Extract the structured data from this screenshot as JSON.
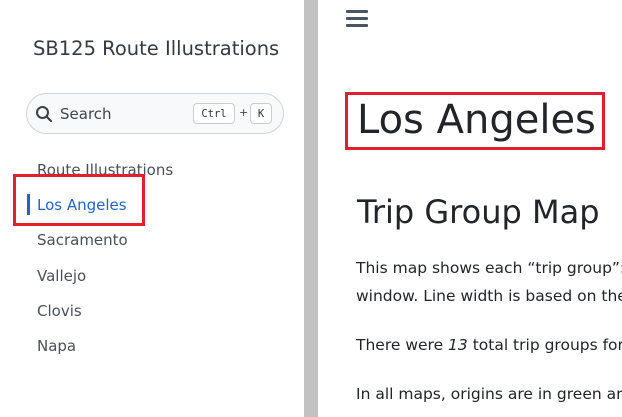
{
  "sidebar": {
    "site_title": "SB125 Route Illustrations",
    "search": {
      "placeholder": "Search",
      "shortcut_ctrl": "Ctrl",
      "shortcut_plus": "+",
      "shortcut_key": "K"
    },
    "items": [
      {
        "label": "Route Illustrations",
        "active": false
      },
      {
        "label": "Los Angeles",
        "active": true
      },
      {
        "label": "Sacramento",
        "active": false
      },
      {
        "label": "Vallejo",
        "active": false
      },
      {
        "label": "Clovis",
        "active": false
      },
      {
        "label": "Napa",
        "active": false
      }
    ]
  },
  "main": {
    "title": "Los Angeles",
    "section_title": "Trip Group Map",
    "para1_line1": "This map shows each “trip group”:",
    "para1_line2": "window. Line width is based on the",
    "para2_prefix": "There were ",
    "para2_count": "13",
    "para2_suffix": " total trip groups for",
    "para3": "In all maps, origins are in green ar"
  },
  "colors": {
    "accent": "#1f63c4",
    "highlight": "#e0202e",
    "text": "#212529"
  },
  "icons": {
    "search": "search-icon",
    "menu": "hamburger-menu-icon"
  }
}
